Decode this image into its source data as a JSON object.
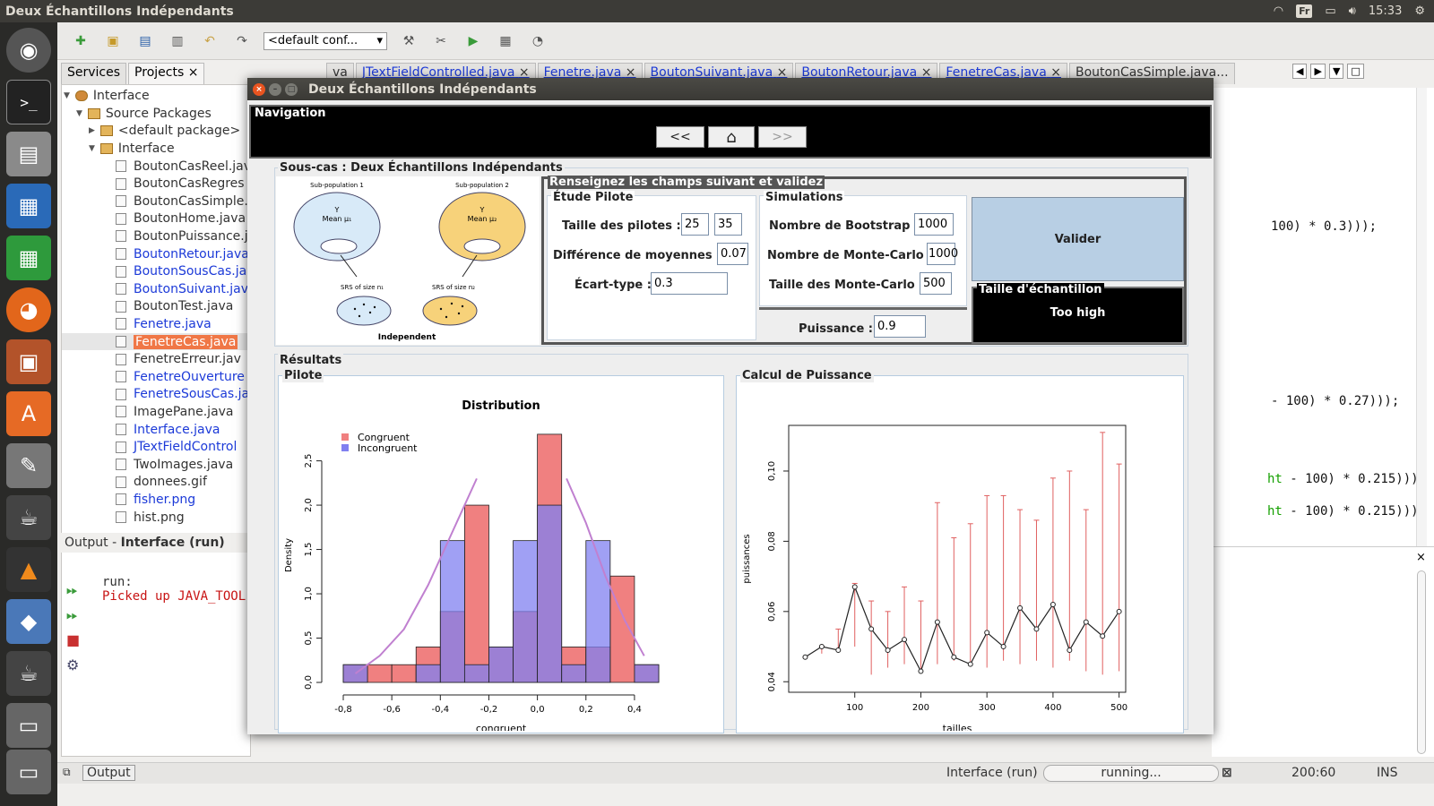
{
  "os": {
    "window_title": "Deux Échantillons Indépendants",
    "keyboard": "Fr",
    "clock": "15:33"
  },
  "ide": {
    "toolbar": {
      "config": "<default conf..."
    },
    "panel_tabs": [
      "Services",
      "Projects"
    ],
    "tree": {
      "root": "Interface",
      "source_packages": "Source Packages",
      "default_package": "<default package>",
      "package": "Interface",
      "files": [
        {
          "name": "BoutonCasReel.java",
          "style": "normal"
        },
        {
          "name": "BoutonCasRegres",
          "style": "normal"
        },
        {
          "name": "BoutonCasSimple.",
          "style": "normal"
        },
        {
          "name": "BoutonHome.java",
          "style": "normal"
        },
        {
          "name": "BoutonPuissance.j",
          "style": "normal"
        },
        {
          "name": "BoutonRetour.java",
          "style": "blue"
        },
        {
          "name": "BoutonSousCas.ja",
          "style": "blue"
        },
        {
          "name": "BoutonSuivant.java",
          "style": "blue"
        },
        {
          "name": "BoutonTest.java",
          "style": "normal"
        },
        {
          "name": "Fenetre.java",
          "style": "blue"
        },
        {
          "name": "FenetreCas.java",
          "style": "selected"
        },
        {
          "name": "FenetreErreur.jav",
          "style": "normal"
        },
        {
          "name": "FenetreOuverture",
          "style": "blue"
        },
        {
          "name": "FenetreSousCas.ja",
          "style": "blue"
        },
        {
          "name": "ImagePane.java",
          "style": "normal"
        },
        {
          "name": "Interface.java",
          "style": "blue"
        },
        {
          "name": "JTextFieldControl",
          "style": "blue"
        },
        {
          "name": "TwoImages.java",
          "style": "normal"
        },
        {
          "name": "donnees.gif",
          "style": "normal"
        },
        {
          "name": "fisher.png",
          "style": "blue"
        },
        {
          "name": "hist.png",
          "style": "normal"
        }
      ]
    },
    "editor_tabs": [
      "va",
      "JTextFieldControlled.java",
      "Fenetre.java",
      "BoutonSuivant.java",
      "BoutonRetour.java",
      "FenetreCas.java",
      "BoutonCasSimple.java..."
    ],
    "code": [
      {
        "text": "100) * 0.3)));",
        "green": ""
      },
      {
        "text": " - 100) * 0.27)));",
        "green": ""
      },
      {
        "text": " - 100) * 0.215)));",
        "green": "ht"
      },
      {
        "text": " - 100) * 0.215)));",
        "green": "ht"
      }
    ],
    "output": {
      "title_prefix": "Output - ",
      "title_project": "Interface (run)",
      "line1": "run:",
      "line2": "Picked up JAVA_TOOL"
    },
    "status": {
      "output_tab": "Output",
      "run_label": "Interface (run)",
      "progress": "running...",
      "position": "200:60",
      "mode": "INS"
    }
  },
  "dialog": {
    "title": "Deux Échantillons Indépendants",
    "navigation": {
      "legend": "Navigation",
      "prev": "<<",
      "next": ">>"
    },
    "sous_cas": {
      "legend": "Sous-cas : Deux Échantillons Indépendants"
    },
    "schema": {
      "sub1": "Sub-population 1",
      "sub2": "Sub-population 2",
      "y": "Y",
      "mean1": "Mean μ₁",
      "mean2": "Mean μ₂",
      "srs1": "SRS of size n₁",
      "srs2": "SRS of size n₂",
      "independent": "Independent"
    },
    "form": {
      "legend": "Renseignez les champs suivant et validez",
      "pilote": {
        "legend": "Étude Pilote",
        "taille_label": "Taille des pilotes :",
        "taille1": "25",
        "taille2": "35",
        "diff_label": "Différence de moyennes :",
        "diff": "0.07",
        "ecart_label": "Écart-type :",
        "ecart": "0.3"
      },
      "simulations": {
        "legend": "Simulations",
        "boot_label": "Nombre de Bootstrap :",
        "boot": "1000",
        "mc_label": "Nombre de Monte-Carlo :",
        "mc": "1000",
        "tmc_label": "Taille des Monte-Carlo :",
        "tmc": "500"
      },
      "puissance_label": "Puissance :",
      "puissance": "0.9",
      "valider": "Valider",
      "taille": {
        "legend": "Taille d'échantillon",
        "value": "Too high"
      }
    },
    "resultats": {
      "legend": "Résultats",
      "pilote": "Pilote",
      "calcul": "Calcul de Puissance"
    }
  },
  "chart_data": [
    {
      "type": "bar",
      "title": "Distribution",
      "xlabel": "congruent",
      "ylabel": "Density",
      "bin_edges": [
        -0.8,
        -0.7,
        -0.6,
        -0.5,
        -0.4,
        -0.3,
        -0.2,
        -0.1,
        0.0,
        0.1,
        0.2,
        0.3,
        0.4,
        0.5
      ],
      "series": [
        {
          "name": "Congruent",
          "color": "#f08080",
          "values": [
            0.2,
            0.2,
            0.2,
            0.4,
            0.8,
            2.0,
            0.4,
            0.8,
            2.8,
            0.4,
            0.4,
            1.2,
            0.2
          ]
        },
        {
          "name": "Incongruent",
          "color": "#8080f0",
          "values": [
            0.2,
            0.0,
            0.0,
            0.2,
            1.6,
            0.2,
            0.4,
            1.6,
            2.0,
            0.2,
            1.6,
            0.0,
            0.2
          ]
        }
      ],
      "curve": {
        "color": "#c080d0",
        "x": [
          -0.75,
          -0.65,
          -0.55,
          -0.45,
          -0.35,
          -0.25
        ],
        "y": [
          0.1,
          0.3,
          0.6,
          1.1,
          1.7,
          2.3
        ],
        "x2": [
          0.12,
          0.2,
          0.28,
          0.36,
          0.44
        ],
        "y2": [
          2.3,
          1.8,
          1.2,
          0.7,
          0.3
        ]
      },
      "xticks": [
        "-0,8",
        "-0,6",
        "-0,4",
        "-0,2",
        "0,0",
        "0,2",
        "0,4"
      ],
      "yticks": [
        "0,0",
        "0,5",
        "1,0",
        "1,5",
        "2,0",
        "2,5"
      ],
      "xlim": [
        -0.8,
        0.5
      ],
      "ylim": [
        0,
        2.9
      ]
    },
    {
      "type": "line",
      "xlabel": "tailles",
      "ylabel": "puissances",
      "x": [
        25,
        50,
        75,
        100,
        125,
        150,
        175,
        200,
        225,
        250,
        275,
        300,
        325,
        350,
        375,
        400,
        425,
        450,
        475,
        500
      ],
      "y": [
        0.047,
        0.05,
        0.049,
        0.067,
        0.055,
        0.049,
        0.052,
        0.043,
        0.057,
        0.047,
        0.045,
        0.054,
        0.05,
        0.061,
        0.055,
        0.062,
        0.049,
        0.057,
        0.053,
        0.06
      ],
      "err_low": [
        0.047,
        0.048,
        0.049,
        0.05,
        0.042,
        0.044,
        0.045,
        0.043,
        0.045,
        0.046,
        0.045,
        0.044,
        0.046,
        0.045,
        0.046,
        0.044,
        0.046,
        0.043,
        0.042,
        0.043
      ],
      "err_high": [
        0.047,
        0.05,
        0.055,
        0.068,
        0.063,
        0.06,
        0.067,
        0.063,
        0.091,
        0.081,
        0.085,
        0.093,
        0.093,
        0.089,
        0.086,
        0.098,
        0.1,
        0.089,
        0.111,
        0.102
      ],
      "xticks": [
        "100",
        "200",
        "300",
        "400",
        "500"
      ],
      "yticks": [
        "0,04",
        "0,06",
        "0,08",
        "0,10"
      ],
      "xlim": [
        0,
        510
      ],
      "ylim": [
        0.037,
        0.113
      ]
    }
  ]
}
